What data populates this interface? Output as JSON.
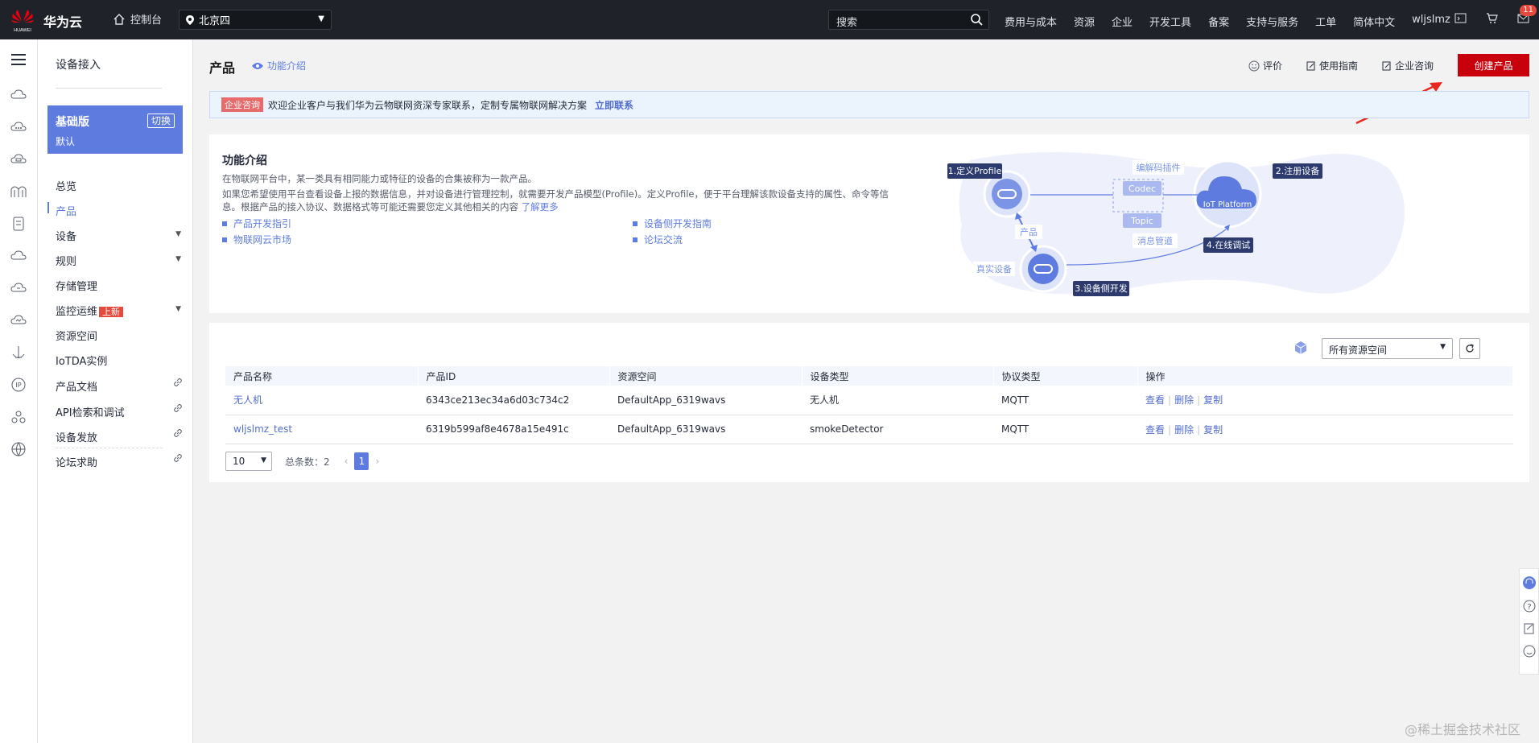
{
  "topbar": {
    "brand": "华为云",
    "brand_small": "HUAWEI",
    "console": "控制台",
    "region": "北京四",
    "search_placeholder": "搜索",
    "nav": [
      "费用与成本",
      "资源",
      "企业",
      "开发工具",
      "备案",
      "支持与服务",
      "工单",
      "简体中文",
      "wljslmz"
    ],
    "message_count": "11"
  },
  "sidebar": {
    "title": "设备接入",
    "plan": {
      "name": "基础版",
      "sub": "默认",
      "switch": "切换"
    },
    "items": [
      {
        "label": "总览"
      },
      {
        "label": "产品"
      },
      {
        "label": "设备"
      },
      {
        "label": "规则"
      },
      {
        "label": "存储管理"
      },
      {
        "label": "监控运维",
        "tag": "上新"
      },
      {
        "label": "资源空间"
      },
      {
        "label": "IoTDA实例"
      },
      {
        "label": "产品文档"
      },
      {
        "label": "API检索和调试"
      },
      {
        "label": "设备发放"
      },
      {
        "label": "论坛求助"
      }
    ]
  },
  "header": {
    "title": "产品",
    "func_link": "功能介绍",
    "actions": [
      "评价",
      "使用指南",
      "企业咨询"
    ],
    "create_button": "创建产品"
  },
  "notice": {
    "tag": "企业咨询",
    "text": "欢迎企业客户与我们华为云物联网资深专家联系，定制专属物联网解决方案",
    "link": "立即联系"
  },
  "intro": {
    "title": "功能介绍",
    "p1": "在物联网平台中，某一类具有相同能力或特征的设备的合集被称为一款产品。",
    "p2": "如果您希望使用平台查看设备上报的数据信息，并对设备进行管理控制，就需要开发产品模型(Profile)。定义Profile，便于平台理解该款设备支持的属性、命令等信息。根据产品的接入协议、数据格式等可能还需要您定义其他相关的内容",
    "p2_link": "了解更多",
    "links": [
      "产品开发指引",
      "设备侧开发指南",
      "物联网云市场",
      "论坛交流"
    ],
    "diagram": {
      "step1": "1.定义Profile",
      "step2": "2.注册设备",
      "step3": "3.设备侧开发",
      "step4": "4.在线调试",
      "codec_plugin": "编解码插件",
      "codec": "Codec",
      "topic": "Topic",
      "msg_pipe": "消息管道",
      "product": "产品",
      "real_device": "真实设备",
      "platform": "IoT Platform"
    }
  },
  "table": {
    "space_select": "所有资源空间",
    "columns": [
      "产品名称",
      "产品ID",
      "资源空间",
      "设备类型",
      "协议类型",
      "操作"
    ],
    "rows": [
      {
        "name": "无人机",
        "id": "6343ce213ec34a6d03c734c2",
        "space": "DefaultApp_6319wavs",
        "type": "无人机",
        "protocol": "MQTT"
      },
      {
        "name": "wljslmz_test",
        "id": "6319b599af8e4678a15e491c",
        "space": "DefaultApp_6319wavs",
        "type": "smokeDetector",
        "protocol": "MQTT"
      }
    ],
    "ops": [
      "查看",
      "删除",
      "复制"
    ]
  },
  "pager": {
    "page_size": "10",
    "total": "总条数：2",
    "page": "1"
  },
  "watermark": "@稀土掘金技术社区",
  "colors": {
    "accent": "#5e7ce0",
    "brand_red": "#c7000b",
    "topbar": "#1f2329"
  }
}
